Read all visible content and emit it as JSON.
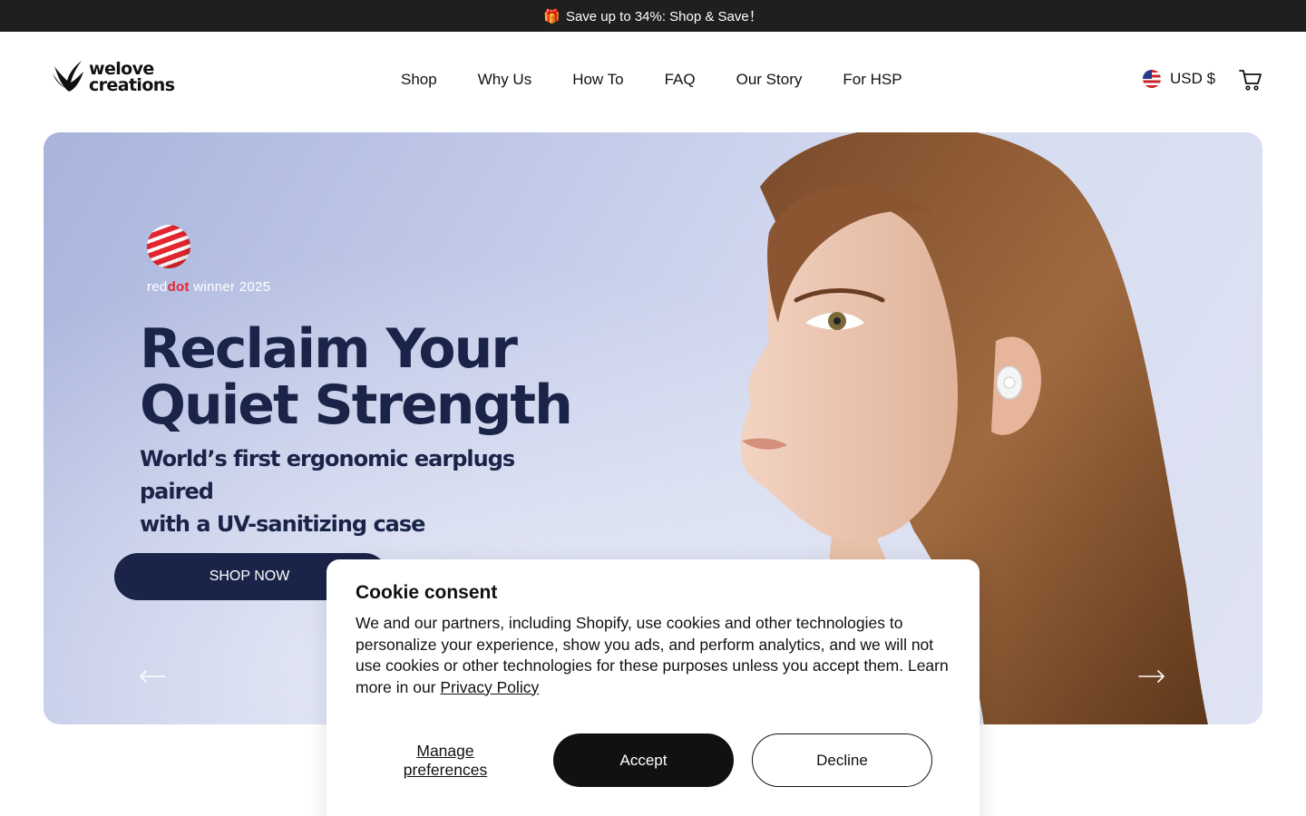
{
  "announcement": {
    "icon": "gift-icon",
    "text": "Save up to 34%: Shop & Save！",
    "gift_glyph": "🎁"
  },
  "header": {
    "logo": {
      "line1": "welove",
      "line2": "creations"
    },
    "nav": [
      {
        "label": "Shop"
      },
      {
        "label": "Why Us"
      },
      {
        "label": "How To"
      },
      {
        "label": "FAQ"
      },
      {
        "label": "Our Story"
      },
      {
        "label": "For HSP"
      }
    ],
    "currency": {
      "label": "USD $",
      "flag": "us-flag-icon"
    },
    "cart": {
      "icon": "cart-icon"
    }
  },
  "hero": {
    "award": {
      "red": "red",
      "dot": "dot",
      "rest": " winner 2025"
    },
    "title_line1": "Reclaim Your",
    "title_line2": "Quiet Strength",
    "subtitle_line1": "World’s first ergonomic earplugs paired",
    "subtitle_line2": "with a UV-sanitizing case",
    "cta": "SHOP NOW"
  },
  "cookie": {
    "title": "Cookie consent",
    "body": "We and our partners, including Shopify, use cookies and other technologies to personalize your experience, show you ads, and perform analytics, and we will not use cookies or other technologies for these purposes unless you accept them. Learn more in our ",
    "privacy_link": "Privacy Policy",
    "manage_line1": "Manage",
    "manage_line2": "preferences",
    "accept": "Accept",
    "decline": "Decline"
  },
  "colors": {
    "navy": "#1a2449",
    "announce_bg": "#1f1f1f",
    "accept_bg": "#111111",
    "reddot": "#e3262f"
  }
}
